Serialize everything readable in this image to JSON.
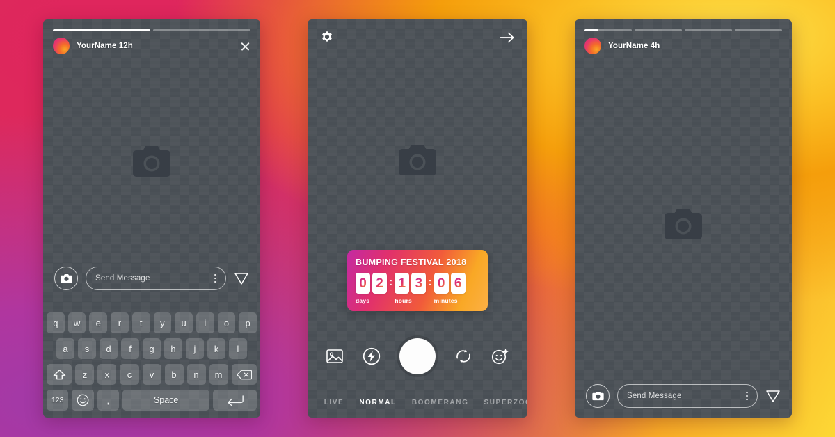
{
  "background": {
    "gradient_colors": [
      "#d62976",
      "#e8392f",
      "#f1622a",
      "#f9a825",
      "#fdd835",
      "#a03aa8"
    ]
  },
  "phone_left": {
    "name": "story-viewer-with-keyboard",
    "progress": {
      "segments": 2,
      "fills": [
        100,
        0
      ]
    },
    "header": {
      "username": "YourName",
      "timestamp": "12h",
      "close_icon": "close-icon"
    },
    "placeholder_icon": "camera-placeholder-icon",
    "message_bar": {
      "camera_icon": "camera-icon",
      "placeholder": "Send Message",
      "more_icon": "more-vertical-icon",
      "send_icon": "send-plane-icon"
    },
    "keyboard": {
      "row1": [
        "q",
        "w",
        "e",
        "r",
        "t",
        "y",
        "u",
        "i",
        "o",
        "p"
      ],
      "row2": [
        "a",
        "s",
        "d",
        "f",
        "g",
        "h",
        "j",
        "k",
        "l"
      ],
      "row3_letters": [
        "z",
        "x",
        "c",
        "v",
        "b",
        "n",
        "m"
      ],
      "shift_icon": "shift-icon",
      "backspace_icon": "backspace-icon",
      "numeric_label": "123",
      "emoji_icon": "emoji-smiley-icon",
      "comma_label": ",",
      "space_label": "Space",
      "return_icon": "return-icon"
    }
  },
  "phone_mid": {
    "name": "camera-capture-screen",
    "top": {
      "settings_icon": "gear-icon",
      "forward_icon": "arrow-right-icon"
    },
    "placeholder_icon": "camera-placeholder-icon",
    "countdown_sticker": {
      "title": "BUMPING FESTIVAL 2018",
      "units": [
        {
          "label": "days",
          "digits": [
            "0",
            "2"
          ]
        },
        {
          "label": "hours",
          "digits": [
            "1",
            "3"
          ]
        },
        {
          "label": "minutes",
          "digits": [
            "0",
            "6"
          ]
        }
      ],
      "separator": ":"
    },
    "controls": {
      "gallery_icon": "gallery-image-icon",
      "flash_icon": "flash-bolt-icon",
      "shutter": "shutter-button",
      "flip_icon": "camera-flip-icon",
      "filters_icon": "face-filter-sparkle-icon"
    },
    "modes": [
      {
        "label": "LIVE",
        "active": false
      },
      {
        "label": "NORMAL",
        "active": true
      },
      {
        "label": "BOOMERANG",
        "active": false
      },
      {
        "label": "SUPERZOOM",
        "active": false
      }
    ]
  },
  "phone_right": {
    "name": "story-viewer-plain",
    "progress": {
      "segments": 4,
      "fills": [
        30,
        0,
        0,
        0
      ]
    },
    "header": {
      "username": "YourName",
      "timestamp": "4h"
    },
    "placeholder_icon": "camera-placeholder-icon",
    "message_bar": {
      "camera_icon": "camera-icon",
      "placeholder": "Send Message",
      "more_icon": "more-vertical-icon",
      "send_icon": "send-plane-icon"
    }
  }
}
